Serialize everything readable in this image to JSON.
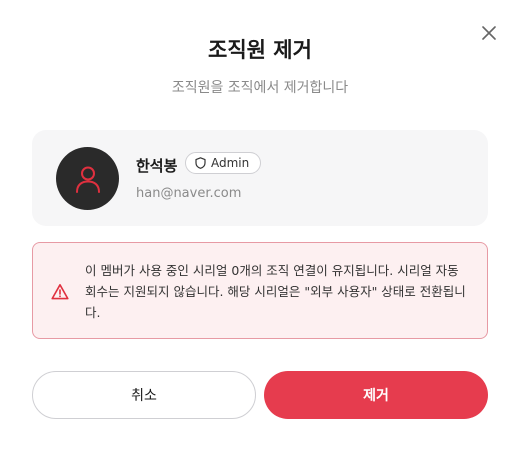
{
  "modal": {
    "title": "조직원 제거",
    "subtitle": "조직원을 조직에서 제거합니다",
    "close_icon": "close-icon"
  },
  "member": {
    "name": "한석봉",
    "role": "Admin",
    "role_icon": "shield-icon",
    "email": "han@naver.com",
    "avatar_icon": "user-icon"
  },
  "warning": {
    "icon": "warning-triangle-icon",
    "message": "이 멤버가 사용 중인 시리얼 0개의 조직 연결이 유지됩니다. 시리얼 자동 회수는 지원되지 않습니다. 해당 시리얼은 \"외부 사용자\" 상태로 전환됩니다."
  },
  "actions": {
    "cancel_label": "취소",
    "remove_label": "제거"
  },
  "colors": {
    "danger": "#e63c4e",
    "warning_bg": "#fdf0f1",
    "warning_border": "#e79aa4",
    "avatar_bg": "#2a2a2a",
    "avatar_icon": "#e0303f"
  }
}
